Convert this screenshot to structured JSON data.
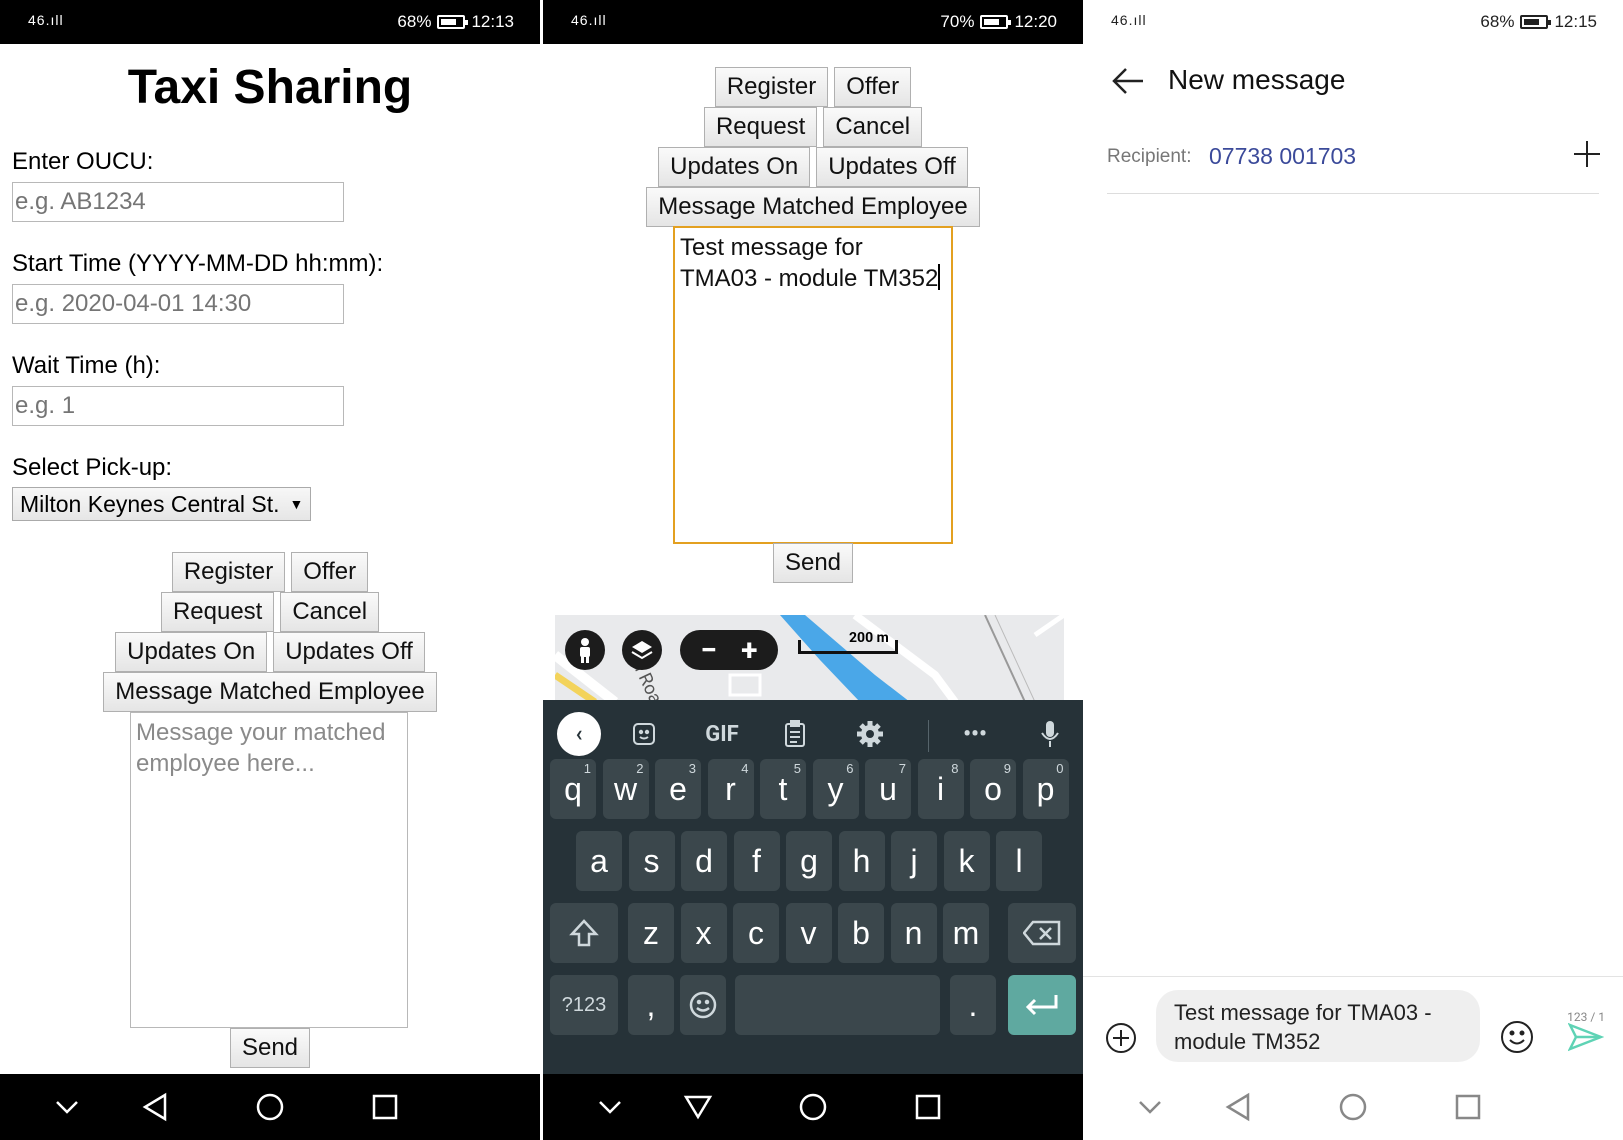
{
  "panel1": {
    "status": {
      "signal": "46.ıll",
      "battery": "68%",
      "time": "12:13"
    },
    "title": "Taxi Sharing",
    "oucu_label": "Enter OUCU:",
    "oucu_placeholder": "e.g. AB1234",
    "start_label": "Start Time (YYYY-MM-DD hh:mm):",
    "start_placeholder": "e.g. 2020-04-01 14:30",
    "wait_label": "Wait Time (h):",
    "wait_placeholder": "e.g. 1",
    "pickup_label": "Select Pick-up:",
    "pickup_value": "Milton Keynes Central St.",
    "buttons": {
      "register": "Register",
      "offer": "Offer",
      "request": "Request",
      "cancel": "Cancel",
      "updates_on": "Updates On",
      "updates_off": "Updates Off",
      "message_matched": "Message Matched Employee",
      "send": "Send"
    },
    "message_placeholder": "Message your matched employee here..."
  },
  "panel2": {
    "status": {
      "signal": "46.ıll",
      "battery": "70%",
      "time": "12:20"
    },
    "buttons": {
      "register": "Register",
      "offer": "Offer",
      "request": "Request",
      "cancel": "Cancel",
      "updates_on": "Updates On",
      "updates_off": "Updates Off",
      "message_matched": "Message Matched Employee",
      "send": "Send"
    },
    "message_text": "Test message for TMA03 - module TM352",
    "map": {
      "scale": "200 m",
      "road_label": "al Roa"
    },
    "keyboard": {
      "gif": "GIF",
      "row1": [
        [
          "q",
          "1"
        ],
        [
          "w",
          "2"
        ],
        [
          "e",
          "3"
        ],
        [
          "r",
          "4"
        ],
        [
          "t",
          "5"
        ],
        [
          "y",
          "6"
        ],
        [
          "u",
          "7"
        ],
        [
          "i",
          "8"
        ],
        [
          "o",
          "9"
        ],
        [
          "p",
          "0"
        ]
      ],
      "row2": [
        "a",
        "s",
        "d",
        "f",
        "g",
        "h",
        "j",
        "k",
        "l"
      ],
      "row3": [
        "z",
        "x",
        "c",
        "v",
        "b",
        "n",
        "m"
      ],
      "symbols": "?123",
      "comma": ",",
      "period": "."
    }
  },
  "panel3": {
    "status": {
      "signal": "46.ıll",
      "battery": "68%",
      "time": "12:15"
    },
    "title": "New message",
    "recipient_label": "Recipient:",
    "recipient_value": "07738 001703",
    "message_text": "Test message for TMA03 - module TM352",
    "counter": "123 / 1",
    "colors": {
      "send": "#5fd3b5",
      "recipient": "#3b4a9a"
    }
  }
}
